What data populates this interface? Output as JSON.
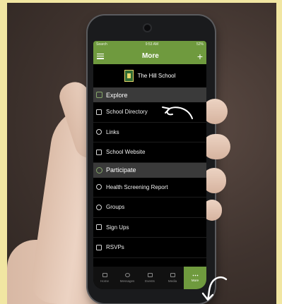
{
  "status_bar": {
    "carrier": "Search",
    "time": "9:53 AM",
    "battery": "52%"
  },
  "app_bar": {
    "title": "More",
    "menu_icon": "hamburger-icon",
    "add_icon": "plus-icon"
  },
  "brand": {
    "name": "The Hill School"
  },
  "sections": [
    {
      "label": "Explore",
      "items": [
        "School Directory",
        "Links",
        "School Website"
      ]
    },
    {
      "label": "Participate",
      "items": [
        "Health Screening Report",
        "Groups",
        "Sign Ups",
        "RSVPs"
      ]
    }
  ],
  "tabs": [
    {
      "label": "Home",
      "icon": "home-icon"
    },
    {
      "label": "Messages",
      "icon": "messages-icon"
    },
    {
      "label": "Events",
      "icon": "calendar-icon"
    },
    {
      "label": "Media",
      "icon": "media-icon"
    },
    {
      "label": "More",
      "icon": "more-icon",
      "active": true
    }
  ],
  "colors": {
    "accent": "#6f9a3e",
    "frame": "#f1e6a2",
    "section_bg": "#3a3a3a"
  }
}
